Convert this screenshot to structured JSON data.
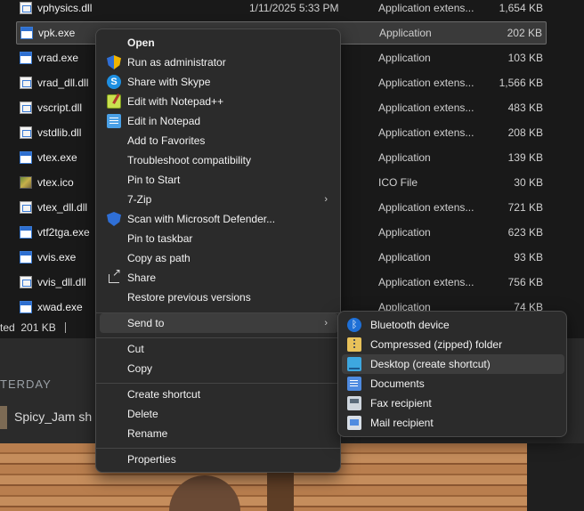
{
  "files": [
    {
      "name": "vphysics.dll",
      "date": "1/11/2025 5:33 PM",
      "type": "Application extens...",
      "size": "1,654 KB",
      "icon": "dll-file-icon"
    },
    {
      "name": "vpk.exe",
      "date": "",
      "type": "Application",
      "size": "202 KB",
      "icon": "exe-file-icon"
    },
    {
      "name": "vrad.exe",
      "date": "",
      "type": "Application",
      "size": "103 KB",
      "icon": "exe-file-icon"
    },
    {
      "name": "vrad_dll.dll",
      "date": "",
      "type": "Application extens...",
      "size": "1,566 KB",
      "icon": "dll-file-icon"
    },
    {
      "name": "vscript.dll",
      "date": "",
      "type": "Application extens...",
      "size": "483 KB",
      "icon": "dll-file-icon"
    },
    {
      "name": "vstdlib.dll",
      "date": "",
      "type": "Application extens...",
      "size": "208 KB",
      "icon": "dll-file-icon"
    },
    {
      "name": "vtex.exe",
      "date": "",
      "type": "Application",
      "size": "139 KB",
      "icon": "exe-file-icon"
    },
    {
      "name": "vtex.ico",
      "date": "",
      "type": "ICO File",
      "size": "30 KB",
      "icon": "ico-file-icon"
    },
    {
      "name": "vtex_dll.dll",
      "date": "",
      "type": "Application extens...",
      "size": "721 KB",
      "icon": "dll-file-icon"
    },
    {
      "name": "vtf2tga.exe",
      "date": "",
      "type": "Application",
      "size": "623 KB",
      "icon": "exe-file-icon"
    },
    {
      "name": "vvis.exe",
      "date": "",
      "type": "Application",
      "size": "93 KB",
      "icon": "exe-file-icon"
    },
    {
      "name": "vvis_dll.dll",
      "date": "",
      "type": "Application extens...",
      "size": "756 KB",
      "icon": "dll-file-icon"
    },
    {
      "name": "xwad.exe",
      "date": "",
      "type": "Application",
      "size": "74 KB",
      "icon": "exe-file-icon"
    }
  ],
  "status": {
    "text": "ted  201 KB"
  },
  "feed": {
    "date_label": "TERDAY",
    "user_text": "Spicy_Jam sh"
  },
  "context_menu": {
    "items": [
      {
        "label": "Open",
        "icon": "",
        "bold": true
      },
      {
        "label": "Run as administrator",
        "icon": "uac-shield-icon"
      },
      {
        "label": "Share with Skype",
        "icon": "skype-icon"
      },
      {
        "label": "Edit with Notepad++",
        "icon": "notepadpp-icon"
      },
      {
        "label": "Edit in Notepad",
        "icon": "notepad-icon"
      },
      {
        "label": "Add to Favorites",
        "icon": ""
      },
      {
        "label": "Troubleshoot compatibility",
        "icon": ""
      },
      {
        "label": "Pin to Start",
        "icon": ""
      },
      {
        "label": "7-Zip",
        "icon": "",
        "submenu": true
      },
      {
        "label": "Scan with Microsoft Defender...",
        "icon": "defender-icon"
      },
      {
        "label": "Pin to taskbar",
        "icon": ""
      },
      {
        "label": "Copy as path",
        "icon": ""
      },
      {
        "label": "Share",
        "icon": "share-icon"
      },
      {
        "label": "Restore previous versions",
        "icon": ""
      },
      {
        "label": "Send to",
        "icon": "",
        "submenu": true,
        "highlighted": true
      },
      {
        "label": "Cut",
        "icon": ""
      },
      {
        "label": "Copy",
        "icon": ""
      },
      {
        "label": "Create shortcut",
        "icon": ""
      },
      {
        "label": "Delete",
        "icon": ""
      },
      {
        "label": "Rename",
        "icon": ""
      },
      {
        "label": "Properties",
        "icon": ""
      }
    ],
    "submenu_arrow": "›"
  },
  "send_to_menu": {
    "items": [
      {
        "label": "Bluetooth device",
        "icon": "bluetooth-icon"
      },
      {
        "label": "Compressed (zipped) folder",
        "icon": "zip-folder-icon"
      },
      {
        "label": "Desktop (create shortcut)",
        "icon": "desktop-icon",
        "highlighted": true
      },
      {
        "label": "Documents",
        "icon": "documents-icon"
      },
      {
        "label": "Fax recipient",
        "icon": "fax-icon"
      },
      {
        "label": "Mail recipient",
        "icon": "mail-icon"
      }
    ]
  }
}
